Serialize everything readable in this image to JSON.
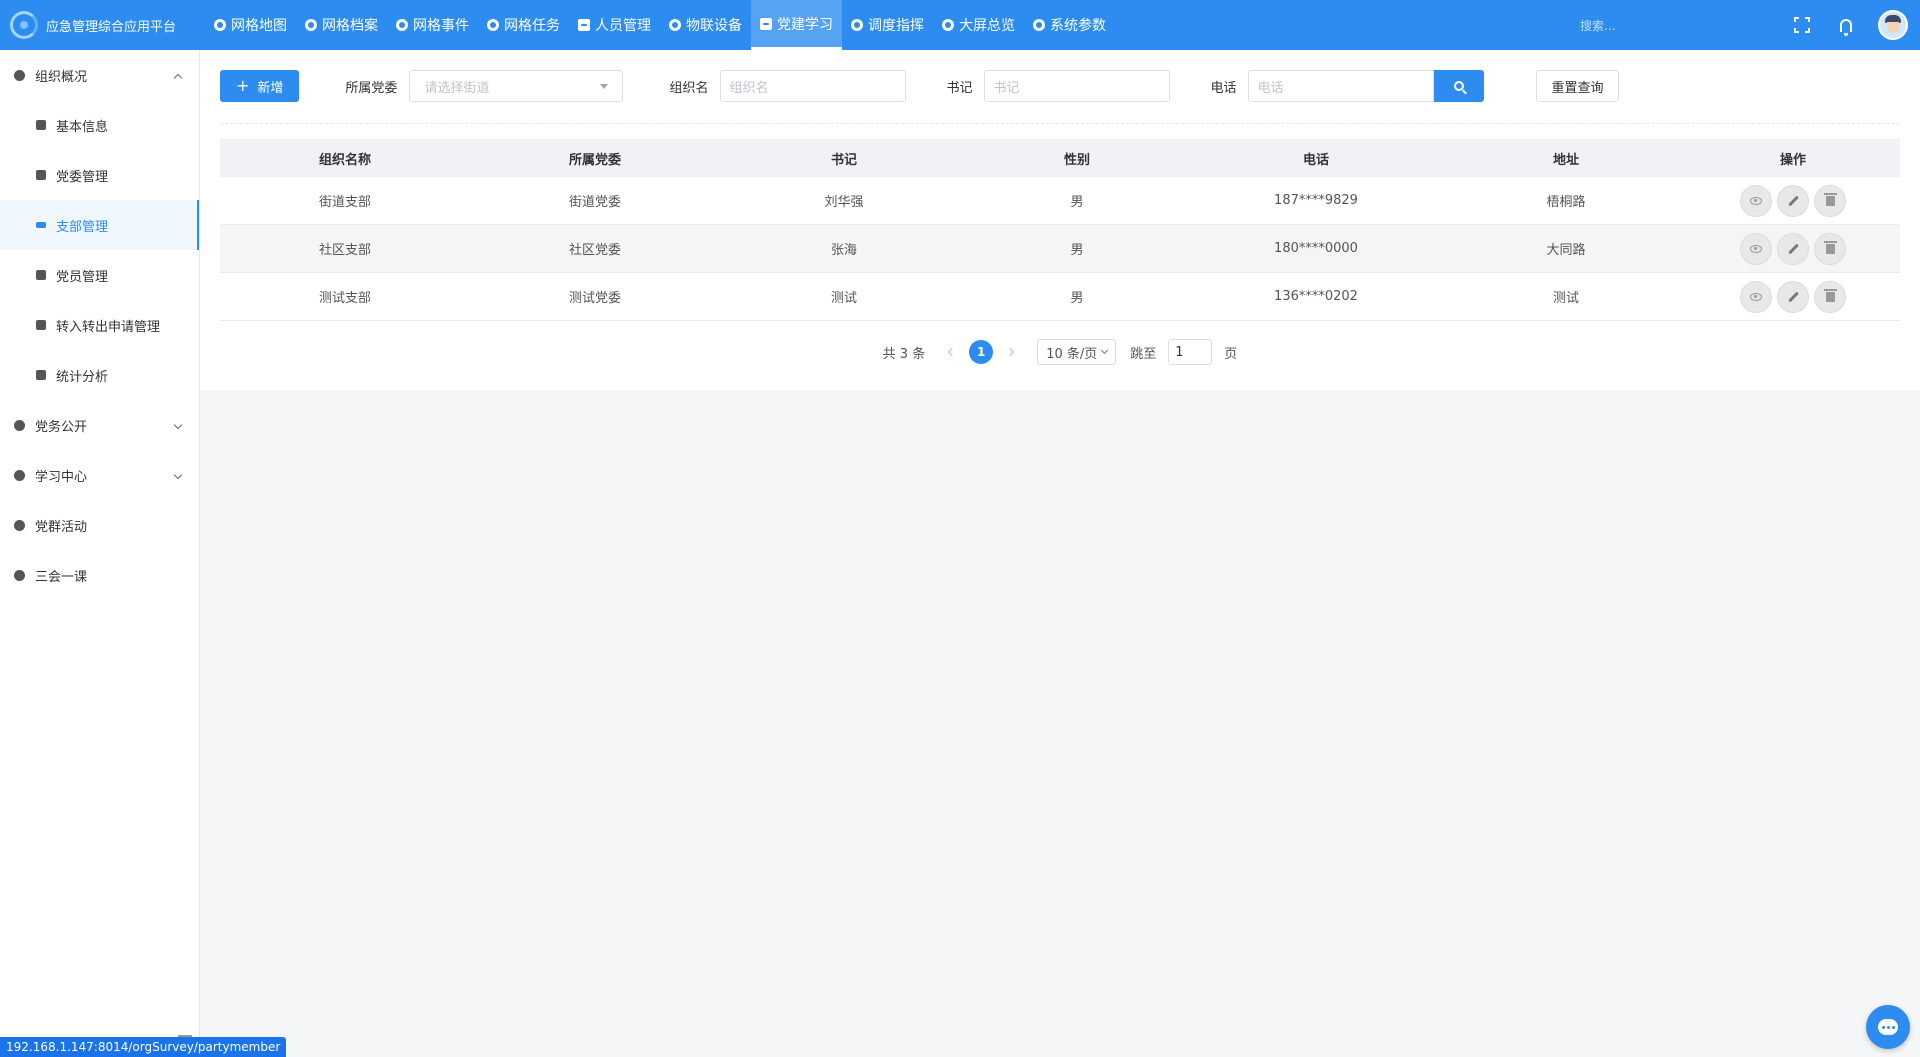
{
  "app": {
    "title": "应急管理综合应用平台"
  },
  "topnav": [
    {
      "label": "网格地图",
      "icon": "globe-icon"
    },
    {
      "label": "网格档案",
      "icon": "cloud-icon"
    },
    {
      "label": "网格事件",
      "icon": "clock-icon"
    },
    {
      "label": "网格任务",
      "icon": "cloud-icon"
    },
    {
      "label": "人员管理",
      "icon": "document-icon"
    },
    {
      "label": "物联设备",
      "icon": "ball-icon"
    },
    {
      "label": "党建学习",
      "icon": "book-icon",
      "active": true
    },
    {
      "label": "调度指挥",
      "icon": "circle-icon"
    },
    {
      "label": "大屏总览",
      "icon": "plus-circle-icon"
    },
    {
      "label": "系统参数",
      "icon": "circle-icon"
    }
  ],
  "header": {
    "search_placeholder": "搜索..."
  },
  "sidebar": {
    "items": [
      {
        "label": "组织概况",
        "level": 1,
        "icon": "org-icon",
        "expanded": true
      },
      {
        "label": "基本信息",
        "level": 2,
        "icon": "info-icon"
      },
      {
        "label": "党委管理",
        "level": 2,
        "icon": "bed-icon"
      },
      {
        "label": "支部管理",
        "level": 2,
        "icon": "card-icon",
        "active": true
      },
      {
        "label": "党员管理",
        "level": 2,
        "icon": "ban-icon"
      },
      {
        "label": "转入转出申请管理",
        "level": 2,
        "icon": "chart-icon"
      },
      {
        "label": "统计分析",
        "level": 2,
        "icon": "pie-icon"
      },
      {
        "label": "党务公开",
        "level": 1,
        "icon": "chat-icon",
        "expanded": false
      },
      {
        "label": "学习中心",
        "level": 1,
        "icon": "share-icon",
        "expanded": false
      },
      {
        "label": "党群活动",
        "level": 1,
        "icon": "leaf-icon"
      },
      {
        "label": "三会一课",
        "level": 1,
        "icon": "thumb-icon"
      }
    ]
  },
  "toolbar": {
    "add_label": "新增",
    "committee_label": "所属党委",
    "committee_placeholder": "请选择街道",
    "org_label": "组织名",
    "org_placeholder": "组织名",
    "secretary_label": "书记",
    "secretary_placeholder": "书记",
    "phone_label": "电话",
    "phone_placeholder": "电话",
    "reset_label": "重置查询"
  },
  "table": {
    "headers": [
      "组织名称",
      "所属党委",
      "书记",
      "性别",
      "电话",
      "地址",
      "操作"
    ],
    "rows": [
      [
        "街道支部",
        "街道党委",
        "刘华强",
        "男",
        "187****9829",
        "梧桐路"
      ],
      [
        "社区支部",
        "社区党委",
        "张海",
        "男",
        "180****0000",
        "大同路"
      ],
      [
        "测试支部",
        "测试党委",
        "测试",
        "男",
        "136****0202",
        "测试"
      ]
    ]
  },
  "pager": {
    "total": "共 3 条",
    "current": "1",
    "page_size": "10 条/页",
    "jump_label": "跳至",
    "jump_value": "1",
    "page_suffix": "页"
  },
  "status_url": "192.168.1.147:8014/orgSurvey/partymember",
  "colors": {
    "primary": "#2d8cf0",
    "background": "#f5f6f8"
  }
}
